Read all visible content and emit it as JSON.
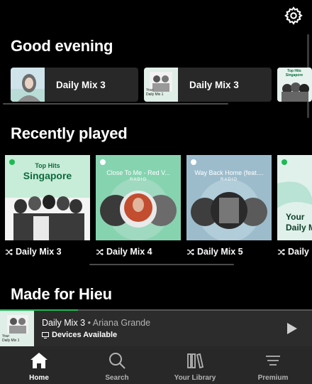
{
  "sections": {
    "good_evening": "Good evening",
    "recently_played": "Recently played",
    "made_for": "Made for Hieu"
  },
  "shortcuts": [
    {
      "label": "Daily Mix 3"
    },
    {
      "label": "Daily Mix 3"
    },
    {
      "label": ""
    }
  ],
  "art_text": {
    "your": "Your",
    "daily_mix_1": "Daily Mix 1",
    "top_hits": "Top Hits",
    "singapore": "Singapore",
    "close_to_me": "Close To Me - Red V...",
    "way_back_home": "Way Back Home (feat....",
    "radio": "RADIO",
    "your_big": "Your",
    "daily_mix_big": "Daily M"
  },
  "recent_cards": [
    {
      "label": "Daily Mix 3"
    },
    {
      "label": "Daily Mix 4"
    },
    {
      "label": "Daily Mix 5"
    },
    {
      "label": "Daily"
    }
  ],
  "now_playing": {
    "title": "Daily Mix 3",
    "separator": " • ",
    "artist": "Ariana Grande",
    "device": "Devices Available",
    "progress": 0.25
  },
  "nav": [
    {
      "label": "Home",
      "icon": "home-icon",
      "active": true
    },
    {
      "label": "Search",
      "icon": "search-icon",
      "active": false
    },
    {
      "label": "Your Library",
      "icon": "library-icon",
      "active": false
    },
    {
      "label": "Premium",
      "icon": "premium-icon",
      "active": false
    }
  ],
  "colors": {
    "accent": "#1db954",
    "card_bg": "#282828",
    "background": "#000000"
  }
}
